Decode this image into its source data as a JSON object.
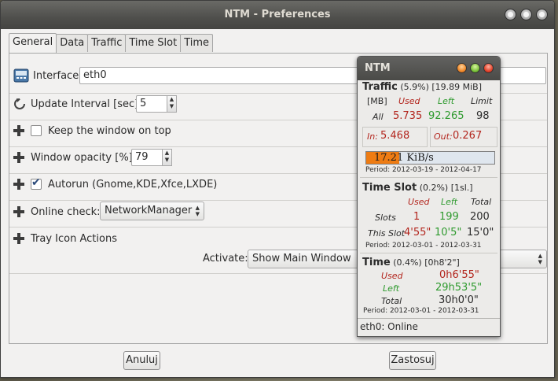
{
  "window": {
    "title": "NTM - Preferences"
  },
  "tabs": [
    "General",
    "Data",
    "Traffic",
    "Time Slot",
    "Time"
  ],
  "general": {
    "interface_label": "Interface:",
    "interface_value": "eth0",
    "update_label": "Update Interval [sec]:",
    "update_value": "5",
    "keep_top_label": "Keep the window on top",
    "opacity_label": "Window opacity [%]:",
    "opacity_value": "79",
    "autorun_label": "Autorun (Gnome,KDE,Xfce,LXDE)",
    "online_label": "Online check:",
    "online_value": "NetworkManager",
    "tray_label": "Tray Icon Actions",
    "activate_label": "Activate:",
    "activate_value": "Show Main Window"
  },
  "buttons": {
    "cancel": "Anuluj",
    "apply": "Zastosuj"
  },
  "ntm": {
    "title": "NTM",
    "traffic": {
      "heading": "Traffic",
      "percent": "(5.9%)",
      "total": "[19.89 MiB]",
      "unit": "[MB]",
      "used_h": "Used",
      "left_h": "Left",
      "limit_h": "Limit",
      "all_label": "All",
      "used": "5.735",
      "left": "92.265",
      "limit": "98",
      "in_label": "In:",
      "in_value": "5.468",
      "out_label": "Out:",
      "out_value": "0.267",
      "speed": "17.21 KiB/s",
      "speed_fill": 0.26,
      "period": "Period: 2012-03-19 - 2012-04-17"
    },
    "timeslot": {
      "heading": "Time Slot",
      "percent": "(0.2%)",
      "slots_info": "[1sl.]",
      "used_h": "Used",
      "left_h": "Left",
      "total_h": "Total",
      "slots_label": "Slots",
      "slots_used": "1",
      "slots_left": "199",
      "slots_total": "200",
      "this_label": "This Slot",
      "this_used": "4'55\"",
      "this_left": "10'5\"",
      "this_total": "15'0\"",
      "period": "Period: 2012-03-01 - 2012-03-31"
    },
    "time": {
      "heading": "Time",
      "percent": "(0.4%)",
      "info": "[0h8'2\"]",
      "used_label": "Used",
      "used_value": "0h6'55\"",
      "left_label": "Left",
      "left_value": "29h53'5\"",
      "total_label": "Total",
      "total_value": "30h0'0\"",
      "period": "Period: 2012-03-01 - 2012-03-31"
    },
    "status": "eth0: Online"
  }
}
